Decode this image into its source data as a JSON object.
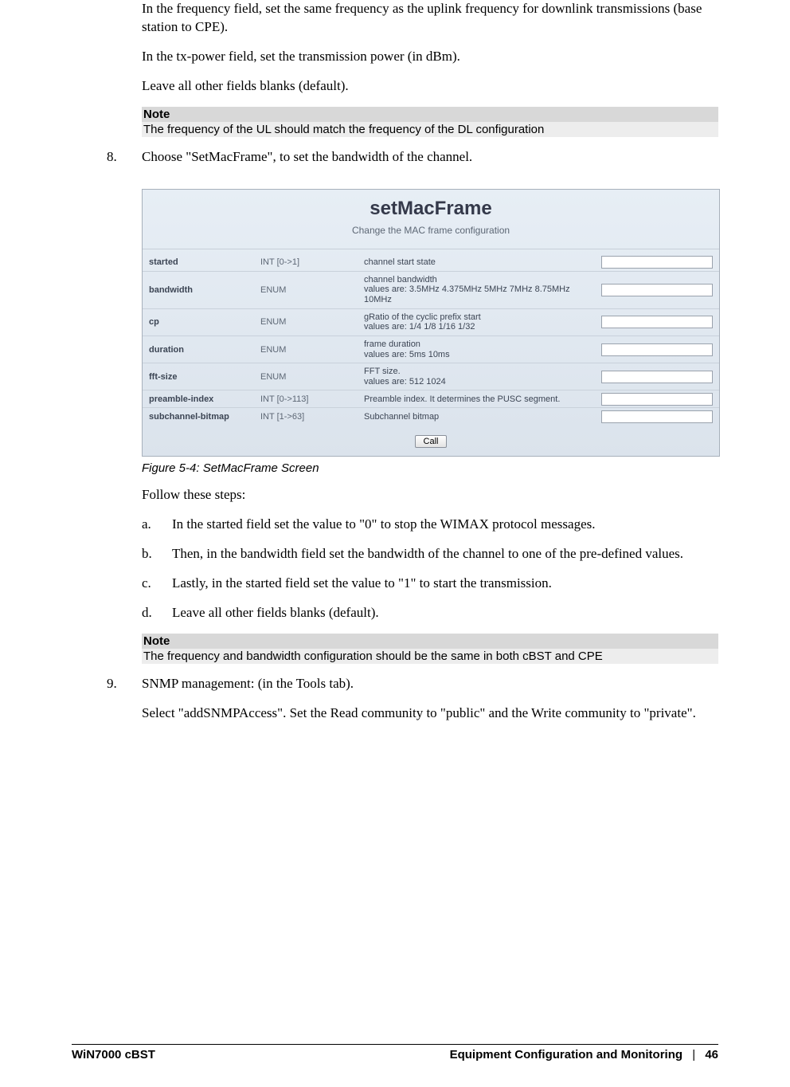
{
  "intro": {
    "p1": "In the frequency field, set the same frequency as the uplink frequency for downlink transmissions (base station to CPE).",
    "p2": "In the tx-power field, set the transmission power (in dBm).",
    "p3": "Leave all other fields blanks (default)."
  },
  "note1": {
    "title": "Note",
    "body": "The frequency of the UL should match the frequency of the DL configuration"
  },
  "item8": {
    "num": "8.",
    "text": "Choose \"SetMacFrame\", to set the bandwidth of the channel."
  },
  "panel": {
    "title": "setMacFrame",
    "sub": "Change the MAC frame configuration",
    "rows": [
      {
        "name": "started",
        "type": "INT [0->1]",
        "desc": "channel start state"
      },
      {
        "name": "bandwidth",
        "type": "ENUM",
        "desc": "channel bandwidth\nvalues are: 3.5MHz 4.375MHz 5MHz 7MHz 8.75MHz 10MHz"
      },
      {
        "name": "cp",
        "type": "ENUM",
        "desc": "gRatio of the cyclic prefix start\nvalues are: 1/4 1/8 1/16 1/32"
      },
      {
        "name": "duration",
        "type": "ENUM",
        "desc": "frame duration\nvalues are: 5ms 10ms"
      },
      {
        "name": "fft-size",
        "type": "ENUM",
        "desc": "FFT size.\nvalues are: 512 1024"
      },
      {
        "name": "preamble-index",
        "type": "INT [0->113]",
        "desc": "Preamble index. It determines the PUSC segment."
      },
      {
        "name": "subchannel-bitmap",
        "type": "INT [1->63]",
        "desc": "Subchannel bitmap"
      }
    ],
    "call": "Call"
  },
  "figcaption": "Figure 5-4: SetMacFrame Screen",
  "follow": "Follow these steps:",
  "steps": {
    "a": {
      "letter": "a.",
      "text": "In the started field set the value to \"0\" to stop the WIMAX protocol messages."
    },
    "b": {
      "letter": "b.",
      "text": "Then, in the bandwidth field set the bandwidth of the channel to one of the pre-defined values."
    },
    "c": {
      "letter": "c.",
      "text": "Lastly, in the started field set the value to \"1\" to start the transmission."
    },
    "d": {
      "letter": "d.",
      "text": "Leave all other fields blanks (default)."
    }
  },
  "note2": {
    "title": "Note",
    "body": "The frequency and bandwidth configuration should be the same in both cBST and CPE"
  },
  "item9": {
    "num": "9.",
    "text": "SNMP management: (in the Tools tab).",
    "p2": "Select \"addSNMPAccess\". Set the Read community to \"public\" and the Write community to \"private\"."
  },
  "footer": {
    "left": "WiN7000 cBST",
    "section": "Equipment Configuration and Monitoring",
    "sep": "|",
    "page": "46"
  }
}
